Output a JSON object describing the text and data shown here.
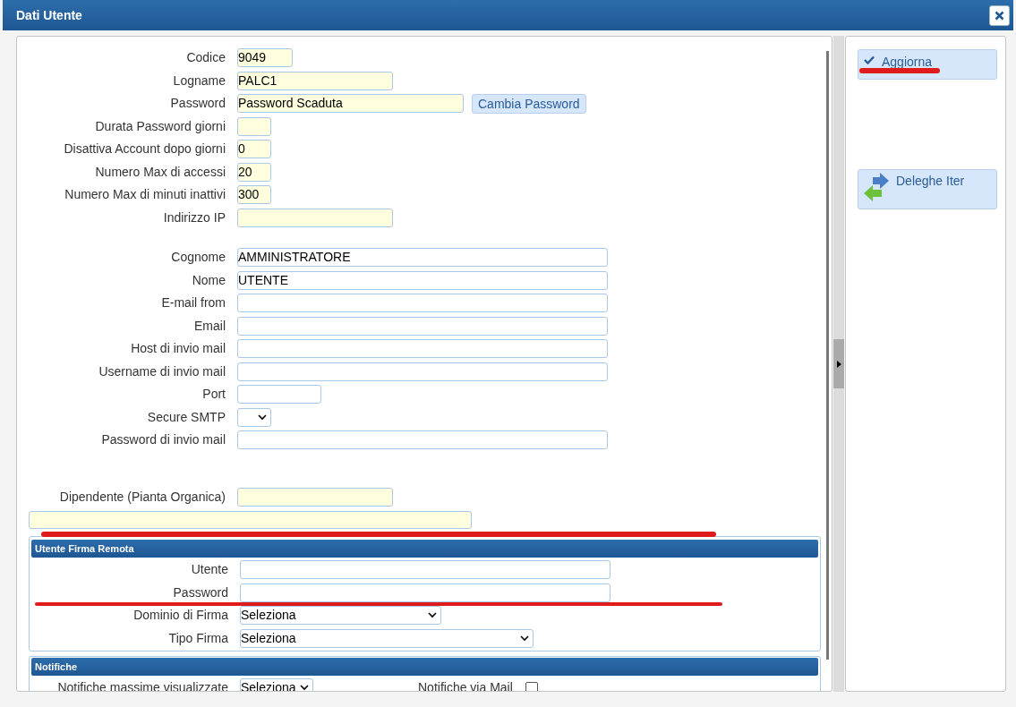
{
  "window": {
    "title": "Dati Utente"
  },
  "groups": [
    {
      "fields": [
        {
          "label": "Codice",
          "kind": "input",
          "value": "9049",
          "highlighted": true
        },
        {
          "label": "Logname",
          "kind": "input",
          "value": "PALC1",
          "highlighted": true
        },
        {
          "label": "Password",
          "kind": "input",
          "value": "Password Scaduta",
          "highlighted": true,
          "button": "Cambia Password"
        },
        {
          "label": "Durata Password giorni",
          "kind": "input",
          "highlighted": true
        },
        {
          "label": "Disattiva Account dopo giorni",
          "kind": "input",
          "value": "0",
          "highlighted": true
        },
        {
          "label": "Numero Max di accessi",
          "kind": "input",
          "value": "20",
          "highlighted": true
        },
        {
          "label": "Numero Max di minuti inattivi",
          "kind": "input",
          "value": "300",
          "highlighted": true
        },
        {
          "label": "Indirizzo IP",
          "kind": "input",
          "highlighted": true
        }
      ]
    },
    {
      "fields": [
        {
          "label": "Cognome",
          "kind": "input",
          "value": "AMMINISTRATORE",
          "highlighted": false
        },
        {
          "label": "Nome",
          "kind": "input",
          "value": "UTENTE",
          "highlighted": false
        },
        {
          "label": "E-mail from",
          "kind": "input",
          "highlighted": false
        },
        {
          "label": "Email",
          "kind": "input",
          "highlighted": false
        },
        {
          "label": "Host di invio mail",
          "kind": "input",
          "highlighted": false
        },
        {
          "label": "Username di invio mail",
          "kind": "input",
          "highlighted": false
        },
        {
          "label": "Port",
          "kind": "input",
          "highlighted": false
        },
        {
          "label": "Secure SMTP",
          "kind": "select"
        },
        {
          "label": "Password di invio mail",
          "kind": "input",
          "highlighted": false
        }
      ]
    },
    {
      "fields": [
        {
          "label": "Dipendente (Pianta Organica)",
          "kind": "input",
          "highlighted": true
        }
      ]
    }
  ],
  "sections": [
    {
      "title": "Utente Firma Remota",
      "fields": [
        {
          "label": "Utente",
          "kind": "input",
          "highlighted": false
        },
        {
          "label": "Password",
          "kind": "input",
          "highlighted": false
        },
        {
          "label": "Dominio di Firma",
          "kind": "select",
          "value": "Seleziona"
        },
        {
          "label": "Tipo Firma",
          "kind": "select",
          "value": "Seleziona"
        }
      ]
    },
    {
      "title": "Notifiche",
      "fields": [
        {
          "label": "Notifiche massime visualizzate",
          "kind": "select",
          "value": "Seleziona"
        },
        {
          "label": "Notifiche via Mail",
          "kind": "checkbox",
          "checked": false
        }
      ]
    }
  ],
  "actions": [
    {
      "label": "Aggiorna",
      "kind": "check"
    },
    {
      "label": "Deleghe Iter",
      "kind": "arrows"
    }
  ]
}
